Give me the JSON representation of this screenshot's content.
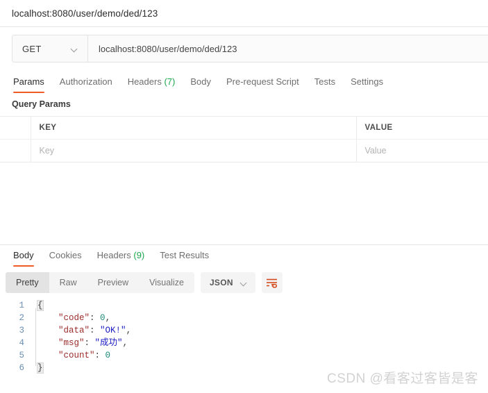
{
  "window": {
    "title": "localhost:8080/user/demo/ded/123"
  },
  "request": {
    "method": "GET",
    "method_chevron_icon": "chevron-down-icon",
    "url": "localhost:8080/user/demo/ded/123",
    "tabs": [
      {
        "label": "Params",
        "count": "",
        "active": true
      },
      {
        "label": "Authorization",
        "count": "",
        "active": false
      },
      {
        "label": "Headers",
        "count": "(7)",
        "active": false
      },
      {
        "label": "Body",
        "count": "",
        "active": false
      },
      {
        "label": "Pre-request Script",
        "count": "",
        "active": false
      },
      {
        "label": "Tests",
        "count": "",
        "active": false
      },
      {
        "label": "Settings",
        "count": "",
        "active": false
      }
    ],
    "section_label": "Query Params",
    "table": {
      "headers": [
        "KEY",
        "VALUE"
      ],
      "rows": [
        {
          "key_placeholder": "Key",
          "value_placeholder": "Value"
        }
      ]
    }
  },
  "response": {
    "tabs": [
      {
        "label": "Body",
        "count": "",
        "active": true
      },
      {
        "label": "Cookies",
        "count": "",
        "active": false
      },
      {
        "label": "Headers",
        "count": "(9)",
        "active": false
      },
      {
        "label": "Test Results",
        "count": "",
        "active": false
      }
    ],
    "format_options": [
      {
        "label": "Pretty",
        "selected": true
      },
      {
        "label": "Raw",
        "selected": false
      },
      {
        "label": "Preview",
        "selected": false
      },
      {
        "label": "Visualize",
        "selected": false
      }
    ],
    "language": "JSON",
    "language_chevron_icon": "chevron-down-icon",
    "wrap_icon": "wrap-text-icon",
    "code": {
      "line_numbers": [
        "1",
        "2",
        "3",
        "4",
        "5",
        "6"
      ],
      "lines": [
        {
          "open_brace": "{"
        },
        {
          "key": "\"code\"",
          "colon": ": ",
          "num": "0",
          "comma": ","
        },
        {
          "key": "\"data\"",
          "colon": ": ",
          "str": "\"OK!\"",
          "comma": ","
        },
        {
          "key": "\"msg\"",
          "colon": ": ",
          "str": "\"成功\"",
          "comma": ","
        },
        {
          "key": "\"count\"",
          "colon": ": ",
          "num": "0",
          "comma": ""
        },
        {
          "close_brace": "}"
        }
      ],
      "raw": "{\n    \"code\": 0,\n    \"data\": \"OK!\",\n    \"msg\": \"成功\",\n    \"count\": 0\n}"
    }
  },
  "watermark": {
    "text": "CSDN @看客过客皆是客"
  },
  "colors": {
    "accent": "#ef5b25",
    "count_green": "#1aa64b",
    "json_key": "#9c2b2b",
    "json_string": "#1a1ac2",
    "json_number": "#1f8a7a",
    "line_number": "#6b8fb5"
  }
}
